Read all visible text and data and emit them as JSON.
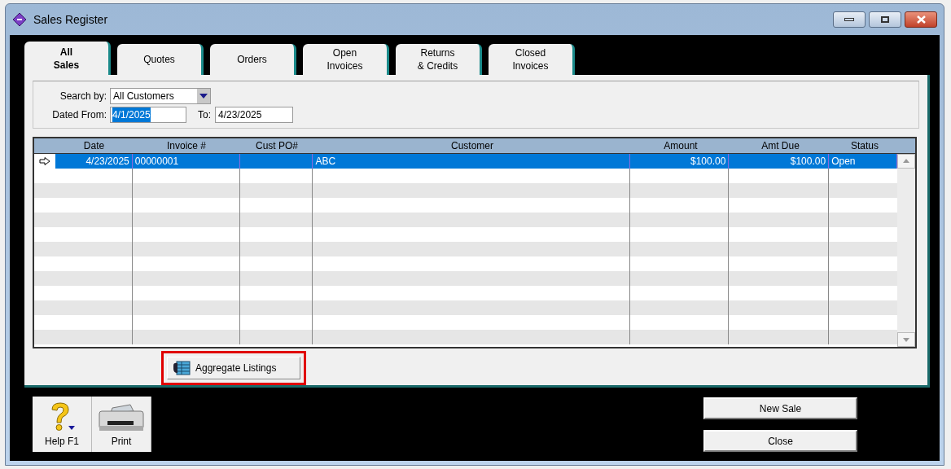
{
  "window": {
    "title": "Sales Register"
  },
  "tabs": [
    {
      "label": "All\nSales",
      "selected": true
    },
    {
      "label": "Quotes",
      "selected": false
    },
    {
      "label": "Orders",
      "selected": false
    },
    {
      "label": "Open\nInvoices",
      "selected": false
    },
    {
      "label": "Returns\n& Credits",
      "selected": false
    },
    {
      "label": "Closed\nInvoices",
      "selected": false
    }
  ],
  "search": {
    "search_by_label": "Search by:",
    "search_by_value": "All Customers",
    "dated_from_label": "Dated From:",
    "dated_from_value": "4/1/2025",
    "to_label": "To:",
    "to_value": "4/23/2025"
  },
  "table": {
    "columns": [
      "Date",
      "Invoice #",
      "Cust PO#",
      "Customer",
      "Amount",
      "Amt Due",
      "Status"
    ],
    "rows": [
      {
        "cells": [
          "4/23/2025",
          "00000001",
          "",
          "ABC",
          "$100.00",
          "$100.00",
          "Open"
        ],
        "selected": true
      }
    ]
  },
  "aggregate_button": {
    "label": "Aggregate Listings",
    "highlighted": true
  },
  "toolbar": [
    {
      "label": "Help F1",
      "kind": "help"
    },
    {
      "label": "Print",
      "kind": "print"
    }
  ],
  "buttons": [
    "New Sale",
    "Close"
  ]
}
